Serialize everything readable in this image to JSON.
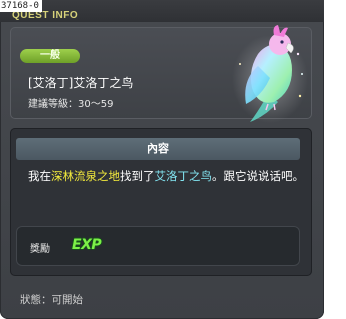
{
  "window": {
    "quest_id": "37168-0",
    "header_label": "QUEST INFO"
  },
  "quest": {
    "category_badge": "一般",
    "title": "[艾洛丁]艾洛丁之鸟",
    "level_label": "建議等級：",
    "level_range": "30～59",
    "icon": "rainbow-bird-illustration"
  },
  "content": {
    "tab_label": "內容",
    "dialog": {
      "p1": "我在",
      "location": "深林流泉之地",
      "p2": "找到了",
      "target": "艾洛丁之鸟",
      "p3": "。跟它说说话吧。"
    },
    "reward_label": "獎勵",
    "reward_badge": "EXP"
  },
  "status": {
    "label": "狀態：",
    "value": "可開始"
  },
  "colors": {
    "accent_title": "#d7d27a",
    "badge_green": "#8cc43c",
    "highlight_location": "#f3ea3c",
    "highlight_npc": "#83e5f2",
    "exp_green": "#7cf048"
  }
}
